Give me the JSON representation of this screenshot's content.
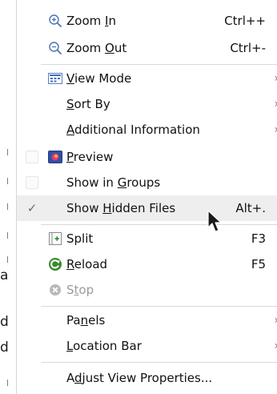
{
  "menu": {
    "zoom_in": {
      "label": "Zoom In",
      "mnemonic_label": "Zoom ",
      "mnemonic_char": "I",
      "rest": "n",
      "shortcut": "Ctrl++"
    },
    "zoom_out": {
      "label": "Zoom Out",
      "prefix": "Zoom ",
      "mnemonic_char": "O",
      "rest": "ut",
      "shortcut": "Ctrl+-"
    },
    "view_mode": {
      "prefix": "",
      "mnemonic_char": "V",
      "rest": "iew Mode",
      "submenu": "›"
    },
    "sort_by": {
      "prefix": "",
      "mnemonic_char": "S",
      "rest": "ort By",
      "submenu": "›"
    },
    "additional_info": {
      "prefix": "",
      "mnemonic_char": "A",
      "rest": "dditional Information",
      "submenu": "›"
    },
    "preview": {
      "prefix": "",
      "mnemonic_char": "P",
      "rest": "review"
    },
    "show_in_groups": {
      "prefix": "Show in ",
      "mnemonic_char": "G",
      "rest": "roups"
    },
    "show_hidden_files": {
      "prefix": "Show ",
      "mnemonic_char": "H",
      "rest": "idden Files",
      "shortcut": "Alt+.",
      "checked": true,
      "check_mark": "✓"
    },
    "split": {
      "label": "Split",
      "shortcut": "F3"
    },
    "reload": {
      "prefix": "",
      "mnemonic_char": "R",
      "rest": "eload",
      "shortcut": "F5"
    },
    "stop": {
      "prefix": "S",
      "mnemonic_char": "t",
      "rest": "op"
    },
    "panels": {
      "prefix": "Pa",
      "mnemonic_char": "n",
      "rest": "els",
      "submenu": "›"
    },
    "location_bar": {
      "prefix": "",
      "mnemonic_char": "L",
      "rest": "ocation Bar",
      "submenu": "›"
    },
    "adjust_view_properties": {
      "prefix": "A",
      "mnemonic_char": "d",
      "rest": "just View Properties..."
    }
  },
  "background": {
    "fragments": [
      "a",
      "d",
      "d"
    ]
  },
  "colors": {
    "highlight": "#eeeeee",
    "disabled_text": "#9a9a9a",
    "zoom_icon": "#4a73b5",
    "reload_icon": "#3a8a2e"
  }
}
